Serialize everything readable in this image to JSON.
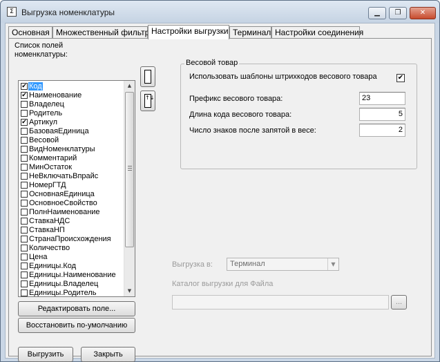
{
  "window": {
    "icon": "Σ",
    "title": "Выгрузка номенклатуры",
    "min_glyph": "▁",
    "max_glyph": "❐",
    "close_glyph": "✕"
  },
  "tabs": [
    {
      "label": "Основная"
    },
    {
      "label": "Множественный фильтр"
    },
    {
      "label": "Настройки выгрузки"
    },
    {
      "label": "Терминал"
    },
    {
      "label": "Настройки соединения"
    }
  ],
  "active_tab": "Настройки выгрузки",
  "fields_list": {
    "label": "Список полей\nноменклатуры:",
    "check_glyph": "✔",
    "items": [
      {
        "label": "Код",
        "checked": true,
        "selected": true
      },
      {
        "label": "Наименование",
        "checked": true
      },
      {
        "label": "Владелец",
        "checked": false
      },
      {
        "label": "Родитель",
        "checked": false
      },
      {
        "label": "Артикул",
        "checked": true
      },
      {
        "label": "БазоваяЕдиница",
        "checked": false
      },
      {
        "label": "Весовой",
        "checked": false
      },
      {
        "label": "ВидНоменклатуры",
        "checked": false
      },
      {
        "label": "Комментарий",
        "checked": false
      },
      {
        "label": "МинОстаток",
        "checked": false
      },
      {
        "label": "НеВключатьВпрайс",
        "checked": false
      },
      {
        "label": "НомерГТД",
        "checked": false
      },
      {
        "label": "ОсновнаяЕдиница",
        "checked": false
      },
      {
        "label": "ОсновноеСвойство",
        "checked": false
      },
      {
        "label": "ПолнНаименование",
        "checked": false
      },
      {
        "label": "СтавкаНДС",
        "checked": false
      },
      {
        "label": "СтавкаНП",
        "checked": false
      },
      {
        "label": "СтранаПроисхождения",
        "checked": false
      },
      {
        "label": "Количество",
        "checked": false
      },
      {
        "label": "Цена",
        "checked": false
      },
      {
        "label": "Единицы.Код",
        "checked": false
      },
      {
        "label": "Единицы.Наименование",
        "checked": false
      },
      {
        "label": "Единицы.Владелец",
        "checked": false
      },
      {
        "label": "Единицы.Родитель",
        "checked": false
      }
    ],
    "scroll_up": "▲",
    "scroll_down": "▼"
  },
  "buttons": {
    "edit_field": "Редактировать поле...",
    "restore_default": "Восстановить по-умолчанию",
    "export": "Выгрузить",
    "close": "Закрыть",
    "move_up_glyph": "",
    "move_down_glyph": "↑↓",
    "browse": "..."
  },
  "weight_goods": {
    "title": "Весовой товар",
    "use_templates_label": "Использовать шаблоны штрихкодов весового товара",
    "use_templates_checked": true,
    "check_glyph": "✔",
    "prefix_label": "Префикс весового товара:",
    "prefix_value": "23",
    "code_length_label": "Длина кода весового товара:",
    "code_length_value": "5",
    "decimals_label": "Число знаков после запятой в весе:",
    "decimals_value": "2"
  },
  "export_target": {
    "label": "Выгрузка в:",
    "value": "Терминал",
    "arrow": "▼",
    "catalog_label": "Каталог выгрузки для Файла",
    "catalog_value": ""
  }
}
